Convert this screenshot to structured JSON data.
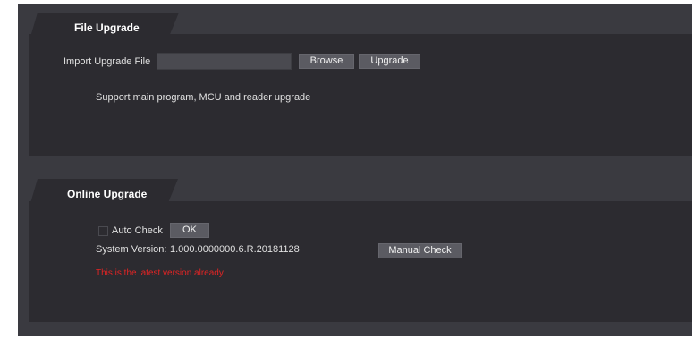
{
  "file_upgrade": {
    "title": "File Upgrade",
    "import_label": "Import Upgrade File",
    "file_input_value": "",
    "browse_label": "Browse",
    "upgrade_label": "Upgrade",
    "support_text": "Support main program, MCU and reader upgrade"
  },
  "online_upgrade": {
    "title": "Online Upgrade",
    "auto_check_label": "Auto Check",
    "auto_check_checked": false,
    "ok_label": "OK",
    "system_version_label": "System Version:",
    "system_version_value": "1.000.0000000.6.R.20181128",
    "manual_check_label": "Manual Check",
    "status_message": "This is the latest version already"
  },
  "colors": {
    "background": "#3a3a40",
    "panel": "#2c2b30",
    "button": "#5b5b62",
    "warning": "#e32424"
  }
}
